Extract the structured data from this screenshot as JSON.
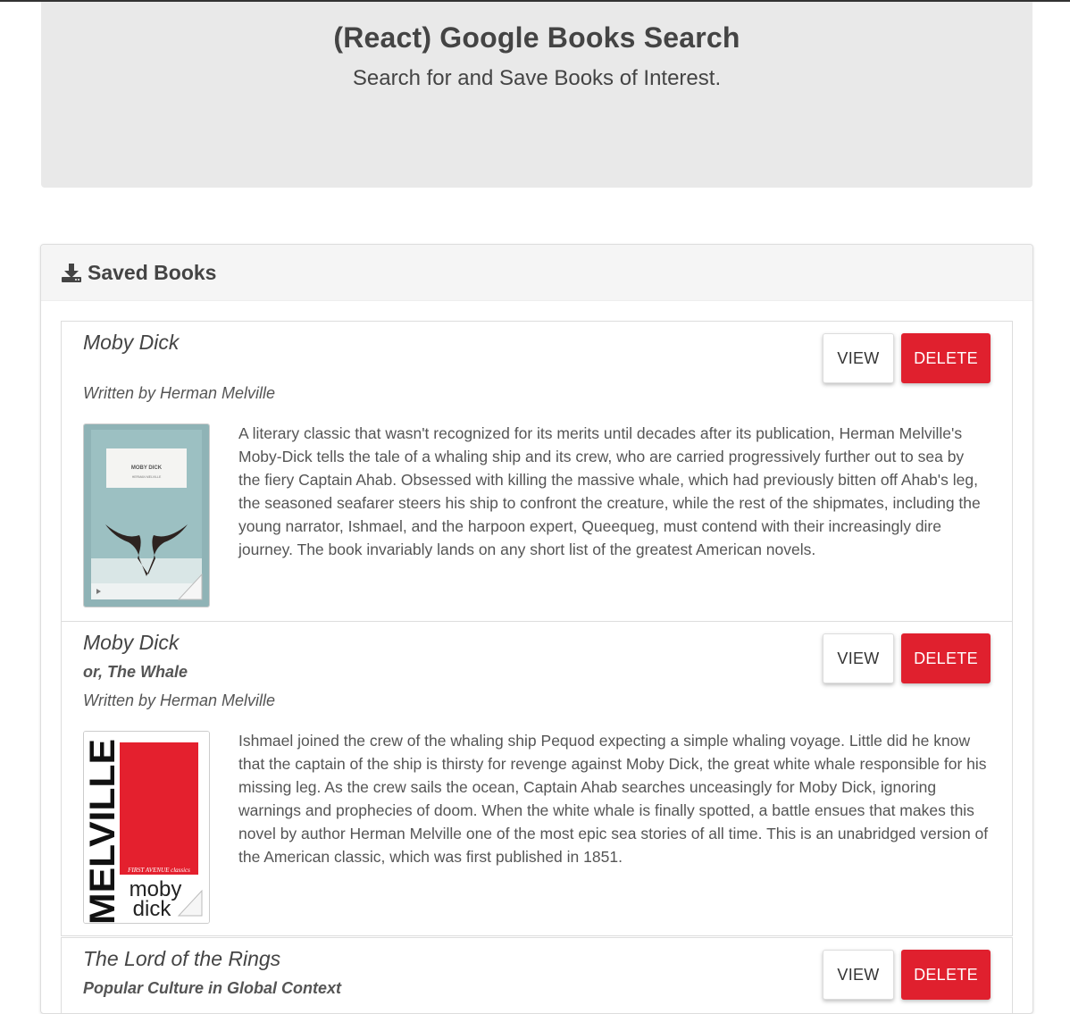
{
  "header": {
    "title": "(React) Google Books Search",
    "subtitle": "Search for and Save Books of Interest."
  },
  "saved": {
    "heading": "Saved Books",
    "icon": "download-icon"
  },
  "books": [
    {
      "title": "Moby Dick",
      "subtitle": "",
      "author": "Written by Herman Melville",
      "view_label": "VIEW",
      "delete_label": "DELETE",
      "cover_text_top": "MOBY DICK",
      "cover_text_author": "HERMAN MELVILLE",
      "description": "A literary classic that wasn't recognized for its merits until decades after its publication, Herman Melville's Moby-Dick tells the tale of a whaling ship and its crew, who are carried progressively further out to sea by the fiery Captain Ahab. Obsessed with killing the massive whale, which had previously bitten off Ahab's leg, the seasoned seafarer steers his ship to confront the creature, while the rest of the shipmates, including the young narrator, Ishmael, and the harpoon expert, Queequeg, must contend with their increasingly dire journey. The book invariably lands on any short list of the greatest American novels."
    },
    {
      "title": "Moby Dick",
      "subtitle": "or, The Whale",
      "author": "Written by Herman Melville",
      "view_label": "VIEW",
      "delete_label": "DELETE",
      "cover_spine": "MELVILLE",
      "cover_series": "FIRST AVENUE classics",
      "cover_word1": "moby",
      "cover_word2": "dick",
      "description": "Ishmael joined the crew of the whaling ship Pequod expecting a simple whaling voyage. Little did he know that the captain of the ship is thirsty for revenge against Moby Dick, the great white whale responsible for his missing leg. As the crew sails the ocean, Captain Ahab searches unceasingly for Moby Dick, ignoring warnings and prophecies of doom. When the white whale is finally spotted, a battle ensues that makes this novel by author Herman Melville one of the most epic sea stories of all time. This is an unabridged version of the American classic, which was first published in 1851."
    },
    {
      "title": "The Lord of the Rings",
      "subtitle": "Popular Culture in Global Context",
      "view_label": "VIEW",
      "delete_label": "DELETE"
    }
  ],
  "colors": {
    "delete": "#e0202e",
    "jumbotron": "#e9e9e9"
  }
}
